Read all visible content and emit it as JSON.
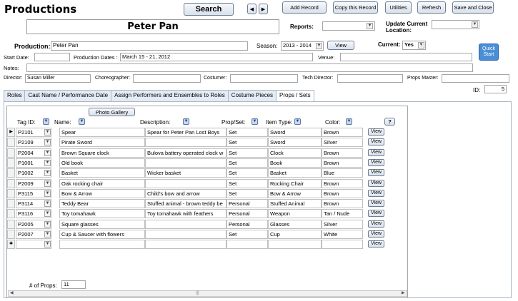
{
  "title": "Productions",
  "toolbar": {
    "search": "Search",
    "nav_prev": "◀",
    "nav_next": "▶",
    "add_record": "Add Record",
    "copy_record": "Copy this Record",
    "utilities": "Utilities",
    "refresh": "Refresh",
    "save_close": "Save and Close"
  },
  "header_name": "Peter Pan",
  "reports_label": "Reports:",
  "reports_value": "",
  "update_location_label": "Update Current Location:",
  "update_location_value": "",
  "quick_start": "Quick Start",
  "form": {
    "production_label": "Production:",
    "production_value": "Peter Pan",
    "season_label": "Season:",
    "season_value": "2013 - 2014",
    "season_view": "View",
    "current_label": "Current:",
    "current_value": "Yes",
    "start_date_label": "Start Date:",
    "start_date_value": "",
    "production_dates_label": "Production Dates :",
    "production_dates_value": "March 15 - 21, 2012",
    "venue_label": "Venue:",
    "venue_value": "",
    "notes_label": "Notes:",
    "notes_value": "",
    "director_label": "Director:",
    "director_value": "Susan Miller",
    "choreographer_label": "Choreographer:",
    "choreographer_value": "",
    "costumer_label": "Costumer:",
    "costumer_value": "",
    "tech_director_label": "Tech Director:",
    "tech_director_value": "",
    "props_master_label": "Props Master:",
    "props_master_value": "",
    "id_label": "ID:",
    "id_value": "5"
  },
  "tabs": [
    "Roles",
    "Cast Name / Performance Date",
    "Assign Performers and Ensembles to Roles",
    "Costume Pieces",
    "Props / Sets"
  ],
  "props": {
    "photo_gallery": "Photo Gallery",
    "help": "?",
    "columns": [
      "Tag ID:",
      "Name:",
      "Description:",
      "Prop/Set:",
      "Item Type:",
      "Color:"
    ],
    "view_label": "View",
    "new_row_marker": "✱",
    "current_row_marker": "▶",
    "rows": [
      {
        "tag": "P2101",
        "name": "Spear",
        "desc": "Spear for Peter Pan Lost Boys",
        "propset": "Set",
        "type": "Sword",
        "color": "Brown"
      },
      {
        "tag": "P2109",
        "name": "Pirate Sword",
        "desc": "",
        "propset": "Set",
        "type": "Sword",
        "color": "Silver"
      },
      {
        "tag": "P2004",
        "name": "Brown Square clock",
        "desc": "Bulova battery operated clock w",
        "propset": "Set",
        "type": "Clock",
        "color": "Brown"
      },
      {
        "tag": "P1001",
        "name": "Old book",
        "desc": "",
        "propset": "Set",
        "type": "Book",
        "color": "Brown"
      },
      {
        "tag": "P1002",
        "name": "Basket",
        "desc": "Wicker basket",
        "propset": "Set",
        "type": "Basket",
        "color": "Blue"
      },
      {
        "tag": "P2009",
        "name": "Oak rocking chair",
        "desc": "",
        "propset": "Set",
        "type": "Rocking Chair",
        "color": "Brown"
      },
      {
        "tag": "P3115",
        "name": "Bow & Arrow",
        "desc": "Child's bow and arrow",
        "propset": "Set",
        "type": "Bow & Arrow",
        "color": "Brown"
      },
      {
        "tag": "P3114",
        "name": "Teddy Bear",
        "desc": "Stuffed animal - brown teddy be",
        "propset": "Personal",
        "type": "Stuffed Animal",
        "color": "Brown"
      },
      {
        "tag": "P3116",
        "name": "Toy tomahawk",
        "desc": "Toy tomahawk with feathers",
        "propset": "Personal",
        "type": "Weapon",
        "color": "Tan / Nude"
      },
      {
        "tag": "P2005",
        "name": "Square glasses",
        "desc": "",
        "propset": "Personal",
        "type": "Glasses",
        "color": "Silver"
      },
      {
        "tag": "P2007",
        "name": "Cup & Saucer with flowers",
        "desc": "",
        "propset": "Set",
        "type": "Cup",
        "color": "White"
      }
    ],
    "count_label": "# of Props:",
    "count_value": "11"
  }
}
